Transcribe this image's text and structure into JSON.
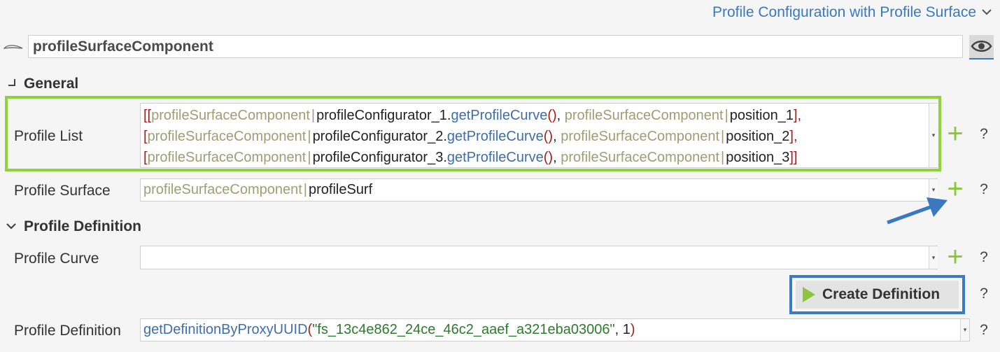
{
  "header": {
    "title": "Profile Configuration with Profile Surface"
  },
  "component": {
    "name": "profileSurfaceComponent"
  },
  "sections": {
    "general": {
      "title": "General"
    },
    "profile_definition": {
      "title": "Profile Definition"
    }
  },
  "fields": {
    "profile_list": {
      "label": "Profile List",
      "lines": [
        {
          "open": "[[",
          "comp": "profileSurfaceComponent",
          "sep": "|",
          "obj": "profileConfigurator_1",
          "dot": ".",
          "fn": "getProfileCurve",
          "parens": "()",
          "comma": ", ",
          "comp2": "profileSurfaceComponent",
          "sep2": "|",
          "ident": "position_1",
          "close": "],"
        },
        {
          "open": "[",
          "comp": "profileSurfaceComponent",
          "sep": "|",
          "obj": "profileConfigurator_2",
          "dot": ".",
          "fn": "getProfileCurve",
          "parens": "()",
          "comma": ", ",
          "comp2": "profileSurfaceComponent",
          "sep2": "|",
          "ident": "position_2",
          "close": "],"
        },
        {
          "open": "[",
          "comp": "profileSurfaceComponent",
          "sep": "|",
          "obj": "profileConfigurator_3",
          "dot": ".",
          "fn": "getProfileCurve",
          "parens": "()",
          "comma": ", ",
          "comp2": "profileSurfaceComponent",
          "sep2": "|",
          "ident": "position_3",
          "close": "]]"
        }
      ]
    },
    "profile_surface": {
      "label": "Profile Surface",
      "comp": "profileSurfaceComponent",
      "sep": "|",
      "ident": "profileSurf"
    },
    "profile_curve": {
      "label": "Profile Curve",
      "value": ""
    },
    "profile_definition": {
      "label": "Profile Definition",
      "fn": "getDefinitionByProxyUUID",
      "open": "(",
      "str": "\"fs_13c4e862_24ce_46c2_aaef_a321eba03006\"",
      "comma": ", ",
      "num": "1",
      "close": ")"
    }
  },
  "buttons": {
    "create_definition": "Create Definition",
    "add": "+",
    "help": "?"
  },
  "icons": {
    "header_chevron": "chevron-down-icon",
    "wing": "wing-profile-icon",
    "eye": "eye-icon",
    "general_toggle": "collapsed-corner-icon",
    "profile_definition_toggle": "chevron-down-icon",
    "play": "play-icon",
    "dropdown": "dropdown-arrow-icon",
    "arrow": "arrow-annotation-icon"
  },
  "colors": {
    "accent_blue": "#3a78c2",
    "add_green": "#8cc63f",
    "highlight_green": "#8fd23a",
    "highlight_blue": "#3a7bc8",
    "component_olive": "#9e9e75",
    "bracket_red": "#a61b1b",
    "string_green": "#2e7a2e"
  }
}
